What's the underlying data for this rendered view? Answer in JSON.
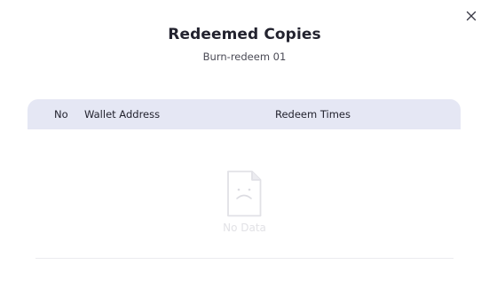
{
  "modal": {
    "title": "Redeemed Copies",
    "subtitle": "Burn-redeem 01",
    "close_icon": "close-icon"
  },
  "table": {
    "columns": [
      "No",
      "Wallet Address",
      "Redeem Times"
    ],
    "rows": [],
    "header_bg": "#e5e7f4"
  },
  "empty_state": {
    "icon": "sad-document-icon",
    "text": "No Data"
  },
  "colors": {
    "title": "#23232f",
    "empty": "#e2e2e6"
  }
}
